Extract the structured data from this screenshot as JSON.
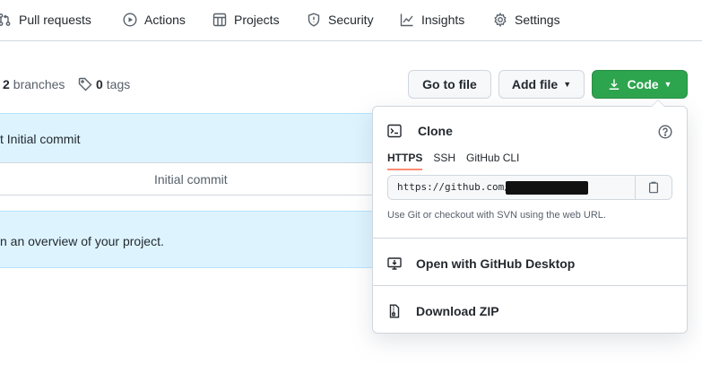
{
  "nav": {
    "items": [
      {
        "label": "Pull requests",
        "icon": "pull-request-icon"
      },
      {
        "label": "Actions",
        "icon": "play-icon"
      },
      {
        "label": "Projects",
        "icon": "table-icon"
      },
      {
        "label": "Security",
        "icon": "shield-icon"
      },
      {
        "label": "Insights",
        "icon": "graph-icon"
      },
      {
        "label": "Settings",
        "icon": "gear-icon"
      }
    ]
  },
  "repo_meta": {
    "branches_count": "2",
    "branches_label": "branches",
    "tags_count": "0",
    "tags_label": "tags"
  },
  "buttons": {
    "go_to_file": "Go to file",
    "add_file": "Add file",
    "code": "Code"
  },
  "files": {
    "latest_commit": "t Initial commit",
    "row_commit_message": "Initial commit",
    "readme_prompt": "n an overview of your project."
  },
  "clone": {
    "title": "Clone",
    "tabs": [
      "HTTPS",
      "SSH",
      "GitHub CLI"
    ],
    "active_tab": "HTTPS",
    "url": "https://github.com/                /path.",
    "hint": "Use Git or checkout with SVN using the web URL.",
    "open_desktop": "Open with GitHub Desktop",
    "download_zip": "Download ZIP"
  },
  "colors": {
    "code_button": "#2da44e",
    "banner_bg": "#ddf4ff",
    "active_tab_underline": "#fd8c73"
  }
}
